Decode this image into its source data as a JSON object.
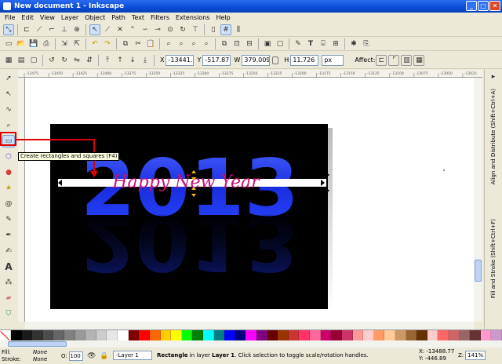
{
  "window": {
    "title": "New document 1 - Inkscape"
  },
  "menu": [
    "File",
    "Edit",
    "View",
    "Layer",
    "Object",
    "Path",
    "Text",
    "Filters",
    "Extensions",
    "Help"
  ],
  "tool_controls": {
    "x_label": "X",
    "x_value": "-13441.",
    "y_label": "Y",
    "y_value": "-517.87",
    "w_label": "W",
    "w_value": "379.009",
    "h_label": "H",
    "h_value": "11.726",
    "unit": "px",
    "affect_label": "Affect:"
  },
  "ruler_ticks": [
    "-13475",
    "-13450",
    "-13425",
    "-13400",
    "-13375",
    "-13350",
    "-13325",
    "-13300",
    "-13275",
    "-13250",
    "-13225",
    "-13200",
    "-13175",
    "-13150",
    "-13125",
    "-13100",
    "-13075",
    "-13050",
    "-13025"
  ],
  "artwork": {
    "year_text": "2013",
    "script_text": "Happy New Year"
  },
  "tooltip": "Create rectangles and squares (F4)",
  "dock_tabs": [
    "Align and Distribute (Shift+Ctrl+A)",
    "Fill and Stroke (Shift+Ctrl+F)"
  ],
  "palette_colors": [
    "#000000",
    "#1a1a1a",
    "#333333",
    "#4d4d4d",
    "#666666",
    "#808080",
    "#999999",
    "#b3b3b3",
    "#cccccc",
    "#e6e6e6",
    "#ffffff",
    "#800000",
    "#ff0000",
    "#ff6600",
    "#ffcc00",
    "#ffff00",
    "#00ff00",
    "#008000",
    "#00ffff",
    "#008080",
    "#0000ff",
    "#000080",
    "#ff00ff",
    "#800080",
    "#660000",
    "#993300",
    "#cc3333",
    "#ff3366",
    "#ff6699",
    "#cc0066",
    "#990033",
    "#cc3366",
    "#ff9999",
    "#ffcccc",
    "#ff9966",
    "#ffcc99",
    "#cc9966",
    "#996633",
    "#663300",
    "#ffcccc",
    "#ff6666",
    "#cc6666",
    "#996666",
    "#663333",
    "#ff99cc",
    "#cc99cc"
  ],
  "status": {
    "fill_label": "Fill:",
    "fill_value": "None",
    "stroke_label": "Stroke:",
    "stroke_value": "None",
    "opacity_label": "O:",
    "opacity_value": "100",
    "layer": "-Layer 1",
    "msg_bold": "Rectangle",
    "msg_mid": " in layer ",
    "msg_layer": "Layer 1",
    "msg_rest": ". Click selection to toggle scale/rotation handles.",
    "x_coord": "X: -13488.77",
    "y_coord": "Y:    -446.89",
    "zoom_label": "Z:",
    "zoom_value": "141%"
  }
}
